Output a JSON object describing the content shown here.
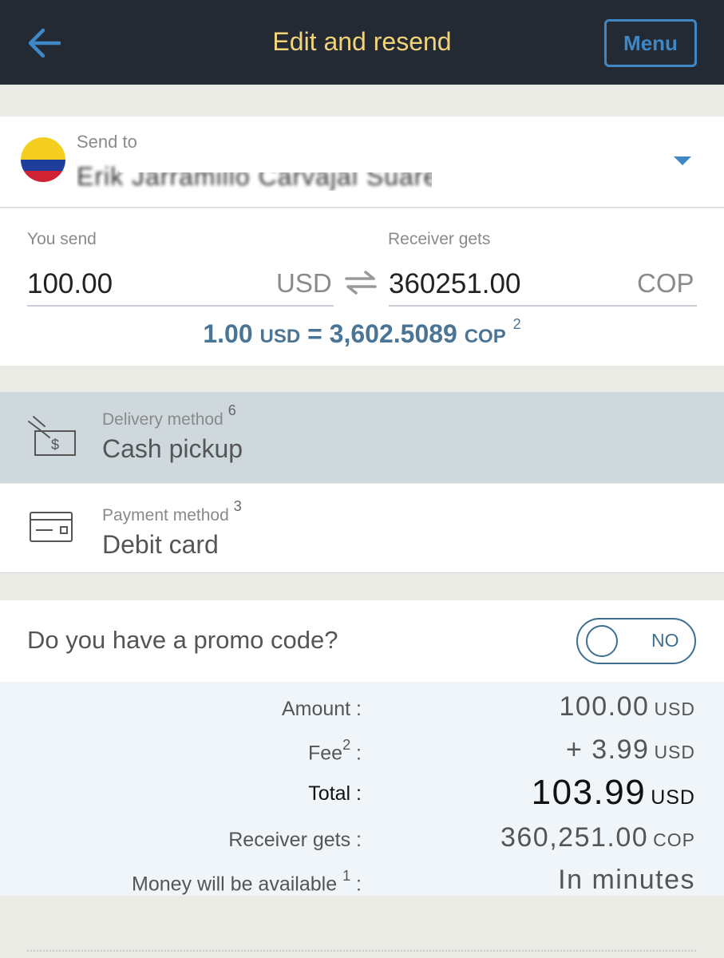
{
  "header": {
    "title": "Edit and resend",
    "menu_label": "Menu"
  },
  "send_to": {
    "label": "Send to",
    "recipient_name": "Erik Jarramillo Carvajal Suarez"
  },
  "amounts": {
    "send_label": "You send",
    "send_value": "100.00",
    "send_currency": "USD",
    "receive_label": "Receiver gets",
    "receive_value": "360251.00",
    "receive_currency": "COP",
    "rate_left": "1.00",
    "rate_left_cur": "USD",
    "rate_eq": "=",
    "rate_right": "3,602.5089",
    "rate_right_cur": "COP",
    "rate_note": "2"
  },
  "delivery": {
    "label": "Delivery method",
    "note": "6",
    "value": "Cash pickup"
  },
  "payment": {
    "label": "Payment method",
    "note": "3",
    "value": "Debit card"
  },
  "promo": {
    "question": "Do you have a promo code?",
    "toggle_state": "NO"
  },
  "summary": {
    "amount_label": "Amount :",
    "amount_value": "100.00",
    "amount_cur": "USD",
    "fee_label": "Fee",
    "fee_note": "2",
    "fee_colon": ":",
    "fee_value": "+ 3.99",
    "fee_cur": "USD",
    "total_label": "Total :",
    "total_value": "103.99",
    "total_cur": "USD",
    "receiver_label": "Receiver gets :",
    "receiver_value": "360,251.00",
    "receiver_cur": "COP",
    "available_label": "Money will be available",
    "available_note": "1",
    "available_colon": ":",
    "available_value": "In minutes"
  },
  "colors": {
    "header_bg": "#232a33",
    "title": "#f0d37a",
    "accent": "#3f88c5",
    "rate_text": "#4a7596",
    "delivery_bg": "#cfd9dd",
    "summary_bg": "#eff5f9"
  },
  "icons": {
    "back": "arrow-left-icon",
    "dropdown": "chevron-down-icon",
    "swap": "swap-arrows-icon",
    "delivery": "cash-hand-icon",
    "payment": "credit-card-icon",
    "flag": "colombia-flag-icon"
  }
}
